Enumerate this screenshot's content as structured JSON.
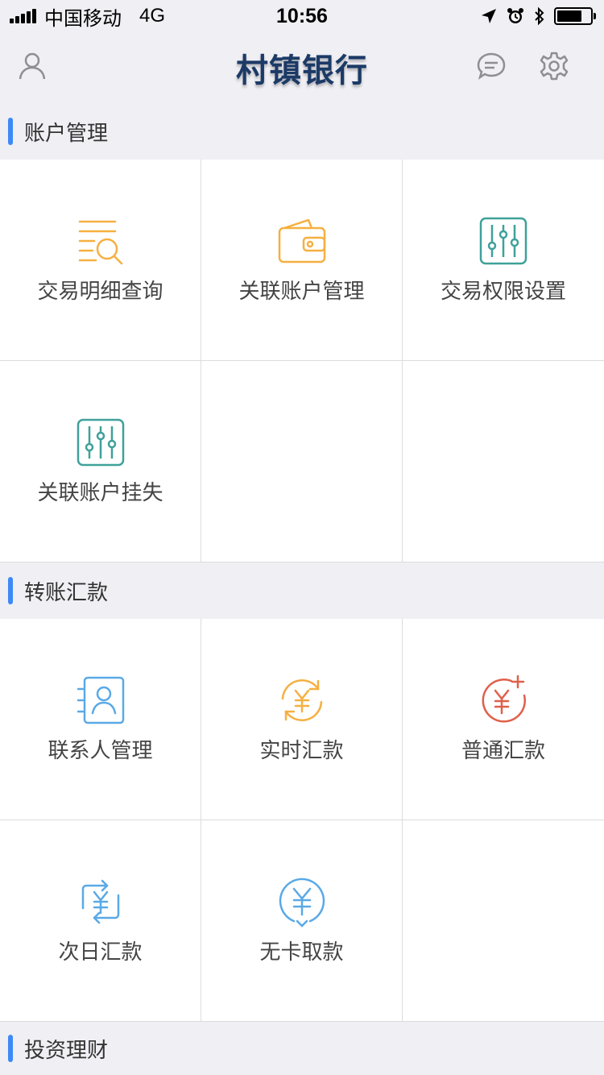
{
  "status_bar": {
    "carrier": "中国移动",
    "network": "4G",
    "time": "10:56"
  },
  "nav": {
    "title": "村镇银行",
    "left_icon": "user-icon",
    "right_icons": [
      "message-icon",
      "gear-icon"
    ]
  },
  "sections": [
    {
      "title": "账户管理",
      "items": [
        {
          "label": "交易明细查询",
          "icon": "search-list-icon",
          "color": "#f5b041"
        },
        {
          "label": "关联账户管理",
          "icon": "wallet-icon",
          "color": "#f5b041"
        },
        {
          "label": "交易权限设置",
          "icon": "sliders-icon",
          "color": "#3fa19a"
        },
        {
          "label": "关联账户挂失",
          "icon": "sliders-icon",
          "color": "#3fa19a"
        }
      ]
    },
    {
      "title": "转账汇款",
      "items": [
        {
          "label": "联系人管理",
          "icon": "contact-card-icon",
          "color": "#5aa9e6"
        },
        {
          "label": "实时汇款",
          "icon": "yuan-refresh-icon",
          "color": "#f5b041"
        },
        {
          "label": "普通汇款",
          "icon": "yuan-plus-icon",
          "color": "#e0604a"
        },
        {
          "label": "次日汇款",
          "icon": "yuan-swap-icon",
          "color": "#5aa9e6"
        },
        {
          "label": "无卡取款",
          "icon": "yuan-withdraw-icon",
          "color": "#5aa9e6"
        }
      ]
    },
    {
      "title": "投资理财"
    }
  ],
  "colors": {
    "accent": "#3d8af7",
    "title": "#1c3a66"
  }
}
